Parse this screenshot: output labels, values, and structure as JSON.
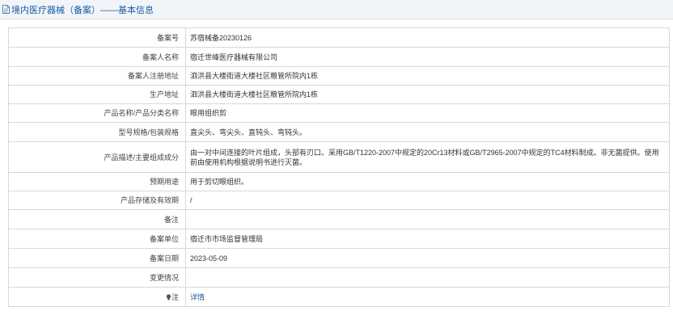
{
  "header": {
    "title": "境内医疗器械（备案）——基本信息",
    "icon": "document-icon"
  },
  "rows": [
    {
      "key": "record_number",
      "label": "备案号",
      "value": "苏宿械备20230126"
    },
    {
      "key": "registrant_name",
      "label": "备案人名称",
      "value": "宿迁世峰医疗器械有限公司"
    },
    {
      "key": "registrant_address",
      "label": "备案人注册地址",
      "value": "泗洪县大楼街道大楼社区粮管所院内1栋"
    },
    {
      "key": "production_address",
      "label": "生产地址",
      "value": "泗洪县大楼街道大楼社区粮管所院内1栋"
    },
    {
      "key": "product_name",
      "label": "产品名称/产品分类名称",
      "value": "眼用组织剪"
    },
    {
      "key": "model_spec",
      "label": "型号规格/包装规格",
      "value": "直尖头、弯尖头、直钝头、弯钝头。"
    },
    {
      "key": "description",
      "label": "产品描述/主要组成成分",
      "value": "由一对中间连接的叶片组成，头部有刃口。采用GB/T1220-2007中规定的20Cr13材料或GB/T2965-2007中规定的TC4材料制成。非无菌提供。使用前由使用机构根据说明书进行灭菌。"
    },
    {
      "key": "intended_use",
      "label": "预期用途",
      "value": "用于剪切眼组织。"
    },
    {
      "key": "storage_validity",
      "label": "产品存储及有效期",
      "value": "/"
    },
    {
      "key": "remarks",
      "label": "备注",
      "value": ""
    },
    {
      "key": "filing_unit",
      "label": "备案单位",
      "value": "宿迁市市场监督管理局"
    },
    {
      "key": "filing_date",
      "label": "备案日期",
      "value": "2023-05-09"
    },
    {
      "key": "change_status",
      "label": "变更情况",
      "value": ""
    }
  ],
  "note_row": {
    "label": "注",
    "icon": "lightbulb-icon",
    "link_text": "详情"
  },
  "colors": {
    "header_bg": "#f1f5fa",
    "header_text": "#1a5a9e",
    "link": "#1a5a9e",
    "border": "#d8d8d8"
  }
}
